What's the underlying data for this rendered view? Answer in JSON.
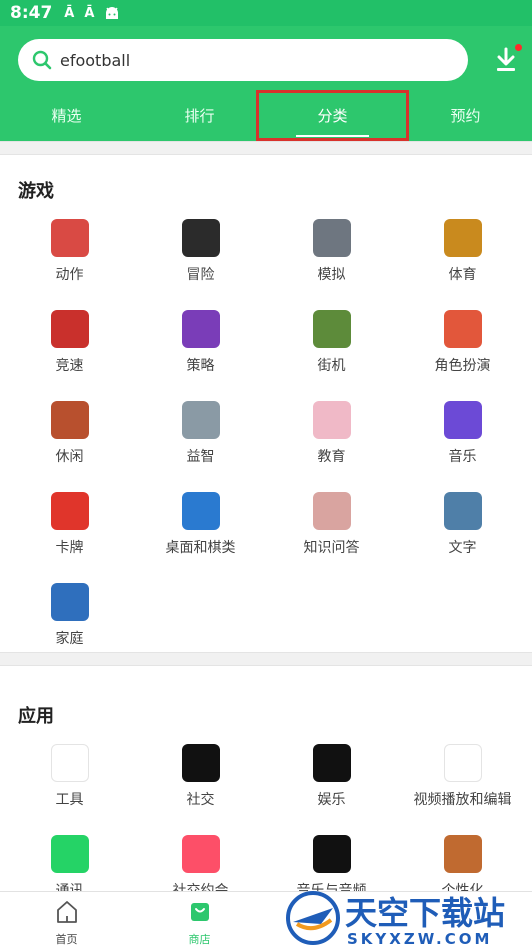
{
  "status": {
    "time": "8:47"
  },
  "search": {
    "value": "efootball"
  },
  "tabs": [
    {
      "label": "精选"
    },
    {
      "label": "排行"
    },
    {
      "label": "分类"
    },
    {
      "label": "预约"
    }
  ],
  "games": {
    "title": "游戏",
    "items": [
      {
        "label": "动作",
        "icon": "action-game-icon",
        "color": "#d94a44"
      },
      {
        "label": "冒险",
        "icon": "roblox-icon",
        "color": "#2b2b2b"
      },
      {
        "label": "模拟",
        "icon": "car-sim-icon",
        "color": "#6e7680"
      },
      {
        "label": "体育",
        "icon": "sports-icon",
        "color": "#c98a1e"
      },
      {
        "label": "竞速",
        "icon": "racing-icon",
        "color": "#c9302c"
      },
      {
        "label": "策略",
        "icon": "strategy-icon",
        "color": "#7a3db8"
      },
      {
        "label": "街机",
        "icon": "minecraft-icon",
        "color": "#5d8b3a"
      },
      {
        "label": "角色扮演",
        "icon": "rpg-icon",
        "color": "#e2573b"
      },
      {
        "label": "休闲",
        "icon": "casual-icon",
        "color": "#b8502e"
      },
      {
        "label": "益智",
        "icon": "puzzle-icon",
        "color": "#8a9aa5"
      },
      {
        "label": "教育",
        "icon": "hello-kitty-icon",
        "color": "#f0b9c7"
      },
      {
        "label": "音乐",
        "icon": "piano-tiles-icon",
        "color": "#6c4ad6"
      },
      {
        "label": "卡牌",
        "icon": "uno-icon",
        "color": "#e0352b"
      },
      {
        "label": "桌面和棋类",
        "icon": "ludo-icon",
        "color": "#2a7ad0"
      },
      {
        "label": "知识问答",
        "icon": "brain-icon",
        "color": "#d9a4a0"
      },
      {
        "label": "文字",
        "icon": "word-icon",
        "color": "#4f7fa8"
      },
      {
        "label": "家庭",
        "icon": "sonic-icon",
        "color": "#2f6fbd"
      }
    ]
  },
  "apps": {
    "title": "应用",
    "items": [
      {
        "label": "工具",
        "icon": "play-store-icon",
        "color": "#ffffff"
      },
      {
        "label": "社交",
        "icon": "tiktok-icon",
        "color": "#111111"
      },
      {
        "label": "娱乐",
        "icon": "netflix-icon",
        "color": "#111111"
      },
      {
        "label": "视频播放和编辑",
        "icon": "youtube-icon",
        "color": "#ffffff"
      },
      {
        "label": "通讯",
        "icon": "whatsapp-icon",
        "color": "#25d366"
      },
      {
        "label": "社交约会",
        "icon": "tinder-icon",
        "color": "#fd4f68"
      },
      {
        "label": "音乐与音频",
        "icon": "spotify-icon",
        "color": "#111111"
      },
      {
        "label": "个性化",
        "icon": "iphone-icon",
        "color": "#c06a30"
      }
    ]
  },
  "nav": [
    {
      "label": "首页"
    },
    {
      "label": "商店"
    }
  ],
  "watermark": {
    "brand": "天空下载站",
    "domain": "SKYXZW.COM"
  },
  "colors": {
    "accent": "#2dc76d",
    "highlight": "#d8322c"
  }
}
